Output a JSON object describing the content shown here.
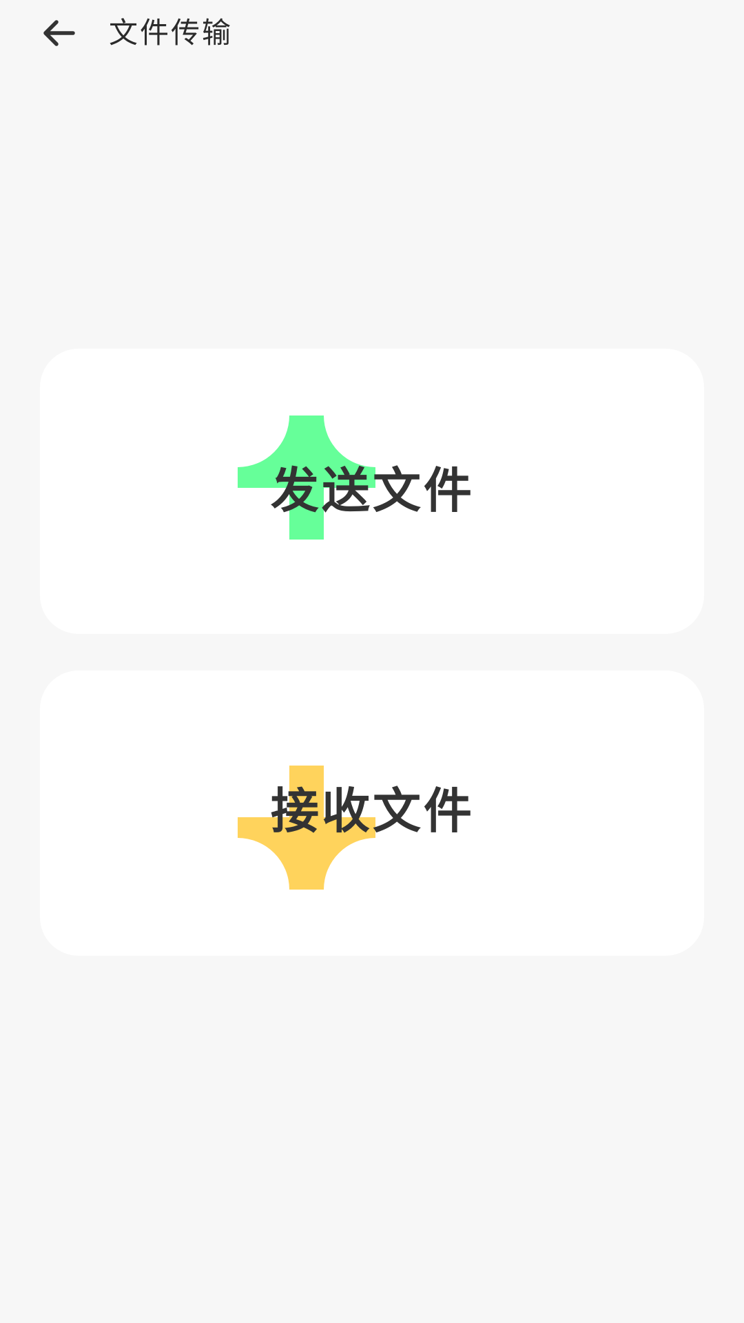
{
  "header": {
    "back_icon": "arrow-left-icon",
    "title": "文件传输"
  },
  "cards": [
    {
      "label": "发送文件",
      "icon": "upload-arrow-icon",
      "icon_color": "#66ff99"
    },
    {
      "label": "接收文件",
      "icon": "download-arrow-icon",
      "icon_color": "#ffd35c"
    }
  ],
  "colors": {
    "background": "#f7f7f7",
    "card": "#ffffff",
    "text": "#333333"
  }
}
